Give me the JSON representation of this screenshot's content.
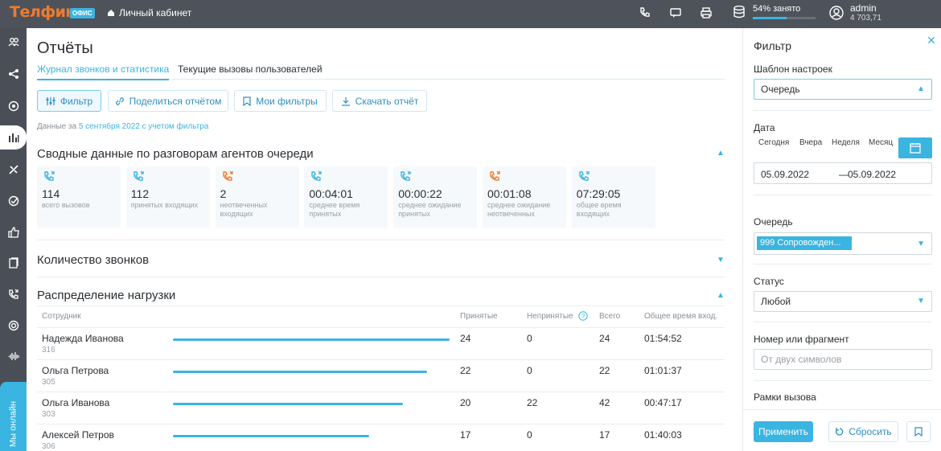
{
  "topbar": {
    "logo": "Телфин",
    "logo_badge": "ОФИС",
    "cabinet": "Личный кабинет",
    "icons": [
      "phone-icon",
      "chat-icon",
      "printer-icon"
    ],
    "storage": {
      "text": "54% занято",
      "percent": 54
    },
    "user": {
      "name": "admin",
      "balance": "4 703,71"
    }
  },
  "sidebar": {
    "items": [
      "contacts-icon",
      "routing-icon",
      "settings-icon",
      "reports-icon",
      "tools-icon",
      "check-icon",
      "like-icon",
      "docs-icon",
      "callback-icon",
      "support-icon",
      "wave-icon"
    ],
    "active": "reports-icon",
    "online_label": "Мы онлайн"
  },
  "main": {
    "title": "Отчёты",
    "tabs": [
      "Журнал звонков и статистика",
      "Текущие вызовы пользователей"
    ],
    "buttons": {
      "filter": "Фильтр",
      "share": "Поделиться отчётом",
      "my_filters": "Мои фильтры",
      "download": "Скачать отчёт"
    },
    "date_prefix": "Данные за",
    "date_highlight": "5 сентября 2022 с учетом фильтра",
    "summary_title": "Сводные данные по разговорам агентов очереди",
    "cards": [
      {
        "value": "114",
        "label": "всего вызовов",
        "color": "#3ab4e0"
      },
      {
        "value": "112",
        "label": "принятых входящих",
        "color": "#3ab4e0"
      },
      {
        "value": "2",
        "label": "неотвеченных входящих",
        "color": "#f07b2b"
      },
      {
        "value": "00:04:01",
        "label": "среднее время принятых",
        "color": "#3ab4e0"
      },
      {
        "value": "00:00:22",
        "label": "среднее ожидание принятых",
        "color": "#3ab4e0"
      },
      {
        "value": "00:01:08",
        "label": "среднее ожидание неотвеченных",
        "color": "#f07b2b"
      },
      {
        "value": "07:29:05",
        "label": "общее время входящих",
        "color": "#3ab4e0"
      }
    ],
    "calls_title": "Количество звонков",
    "load_title": "Распределение нагрузки",
    "table": {
      "headers": {
        "employee": "Сотрудник",
        "accepted": "Принятые",
        "missed": "Непринятые",
        "total": "Всего",
        "time": "Общее время вход."
      },
      "rows": [
        {
          "name": "Надежда Иванова",
          "ext": "316",
          "accepted": "24",
          "missed": "0",
          "total": "24",
          "time": "01:54:52",
          "load": 1.0
        },
        {
          "name": "Ольга Петрова",
          "ext": "305",
          "accepted": "22",
          "missed": "0",
          "total": "22",
          "time": "01:01:37",
          "load": 0.92
        },
        {
          "name": "Ольга Иванова",
          "ext": "303",
          "accepted": "20",
          "missed": "22",
          "total": "42",
          "time": "00:47:17",
          "load": 0.83
        },
        {
          "name": "Алексей Петров",
          "ext": "306",
          "accepted": "17",
          "missed": "0",
          "total": "17",
          "time": "01:40:03",
          "load": 0.71
        }
      ]
    }
  },
  "panel": {
    "title": "Фильтр",
    "template_label": "Шаблон настроек",
    "template_value": "Очередь",
    "date_label": "Дата",
    "periods": [
      "Сегодня",
      "Вчера",
      "Неделя",
      "Месяц"
    ],
    "date_from": "05.09.2022",
    "date_to": "05.09.2022",
    "queue_label": "Очередь",
    "queue_value": "999 Сопровожден...",
    "status_label": "Статус",
    "status_value": "Любой",
    "number_label": "Номер или фрагмент",
    "number_placeholder": "От двух символов",
    "frames_label": "Рамки вызова",
    "apply": "Применить",
    "reset": "Сбросить"
  }
}
